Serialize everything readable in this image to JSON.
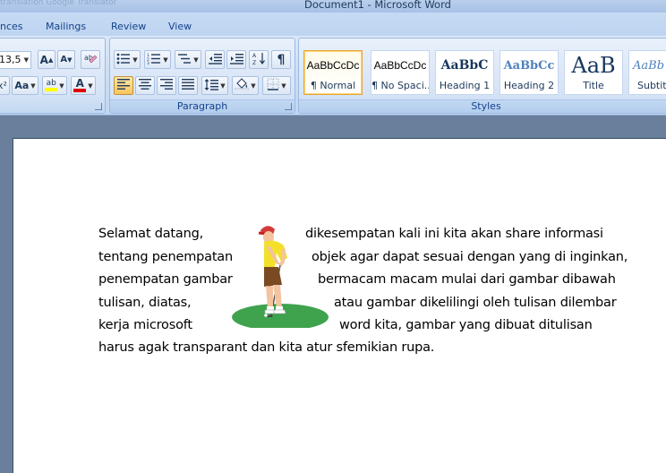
{
  "window": {
    "title": "Document1 - Microsoft Word",
    "faded_left": "translation  Google Translator"
  },
  "tabs": [
    {
      "label": "nces"
    },
    {
      "label": "Mailings"
    },
    {
      "label": "Review"
    },
    {
      "label": "View"
    }
  ],
  "font_group": {
    "font_size": "13,5",
    "grow_label": "A",
    "shrink_label": "A",
    "change_case_label": "Aa",
    "superscript_label": "x²",
    "highlight_label": "ab",
    "font_color_label": "A",
    "highlight_color": "#ffff00",
    "font_color": "#e00000"
  },
  "paragraph_group": {
    "label": "Paragraph",
    "show_marks_label": "¶",
    "sort_label": "A↓Z"
  },
  "styles_group": {
    "label": "Styles",
    "items": [
      {
        "sample": "AaBbCcDc",
        "label": "¶ Normal"
      },
      {
        "sample": "AaBbCcDc",
        "label": "¶ No Spaci..."
      },
      {
        "sample": "AaBbC",
        "label": "Heading 1"
      },
      {
        "sample": "AaBbCc",
        "label": "Heading 2"
      },
      {
        "sample": "AaB",
        "label": "Title"
      },
      {
        "sample": "AaBb",
        "label": "Subtit"
      }
    ]
  },
  "document": {
    "lines": [
      "Selamat datang,                          dikesempatan kali ini kita akan share informasi",
      "tentang penempatan                       objek agar dapat sesuai dengan yang di inginkan,",
      "penempatan gambar                          bermacam macam mulai dari gambar dibawah",
      "tulisan, diatas,                                   atau gambar dikelilingi oleh tulisan dilembar",
      "kerja microsoft                                    word kita, gambar yang dibuat  ditulisan",
      "harus agak transparant dan kita atur sfemikian rupa."
    ],
    "segments": [
      {
        "left": "Selamat datang,",
        "right": "dikesempatan kali ini kita akan share informasi"
      },
      {
        "left": "tentang penempatan",
        "right": "objek agar dapat sesuai dengan yang di inginkan,"
      },
      {
        "left": "penempatan gambar",
        "right": "bermacam macam mulai dari gambar dibawah"
      },
      {
        "left": "tulisan, diatas,",
        "right": "atau gambar dikelilingi oleh tulisan dilembar"
      },
      {
        "left": "kerja microsoft",
        "right": "word kita, gambar yang dibuat  ditulisan"
      },
      {
        "left": "harus agak transparant dan kita atur sfemikian rupa.",
        "right": ""
      }
    ]
  }
}
